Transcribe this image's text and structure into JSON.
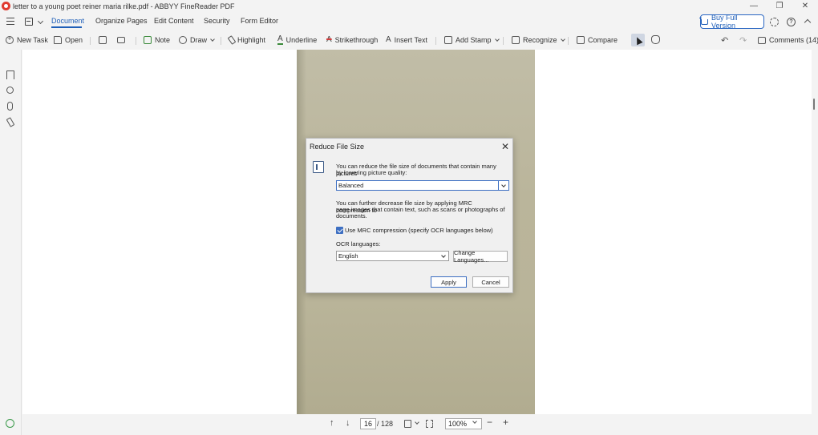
{
  "window": {
    "title": "letter to a young poet reiner maria rilke.pdf - ABBYY FineReader PDF",
    "controls": {
      "minimize": "—",
      "restore": "❐",
      "close": "✕"
    }
  },
  "menu": {
    "tabs": [
      {
        "label": "Document",
        "active": true
      },
      {
        "label": "Organize Pages"
      },
      {
        "label": "Edit Content"
      },
      {
        "label": "Security"
      },
      {
        "label": "Form Editor"
      }
    ],
    "buy_label": "Buy Full Version",
    "help_glyph": "?"
  },
  "toolbar": {
    "new_task": "New Task",
    "open": "Open",
    "note": "Note",
    "draw": "Draw",
    "highlight": "Highlight",
    "underline": "Underline",
    "strikethrough": "Strikethrough",
    "insert_text": "Insert Text",
    "add_stamp": "Add Stamp",
    "recognize": "Recognize",
    "compare": "Compare",
    "comments": "Comments (14)",
    "underline_glyph": "A",
    "strike_glyph": "A",
    "insert_glyph": "A",
    "undo_glyph": "↶",
    "redo_glyph": "↷"
  },
  "bottom": {
    "current_page": "16",
    "total_pages": "/ 128",
    "zoom": "100%",
    "up_glyph": "↑",
    "down_glyph": "↓",
    "zoom_out": "−",
    "zoom_in": "+"
  },
  "dialog": {
    "title": "Reduce File Size",
    "close_glyph": "✕",
    "intro_line1": "You can reduce the file size of documents that contain many pictures",
    "intro_line2": "by lowering picture quality:",
    "quality_value": "Balanced",
    "mrc_line1": "You can further decrease file size by applying MRC compression to",
    "mrc_line2": "page images that contain text, such as scans or photographs of",
    "mrc_line3": "documents.",
    "mrc_checkbox_label": "Use MRC compression (specify OCR languages below)",
    "ocr_label": "OCR languages:",
    "ocr_value": "English",
    "change_languages": "Change Languages...",
    "apply": "Apply",
    "cancel": "Cancel"
  }
}
